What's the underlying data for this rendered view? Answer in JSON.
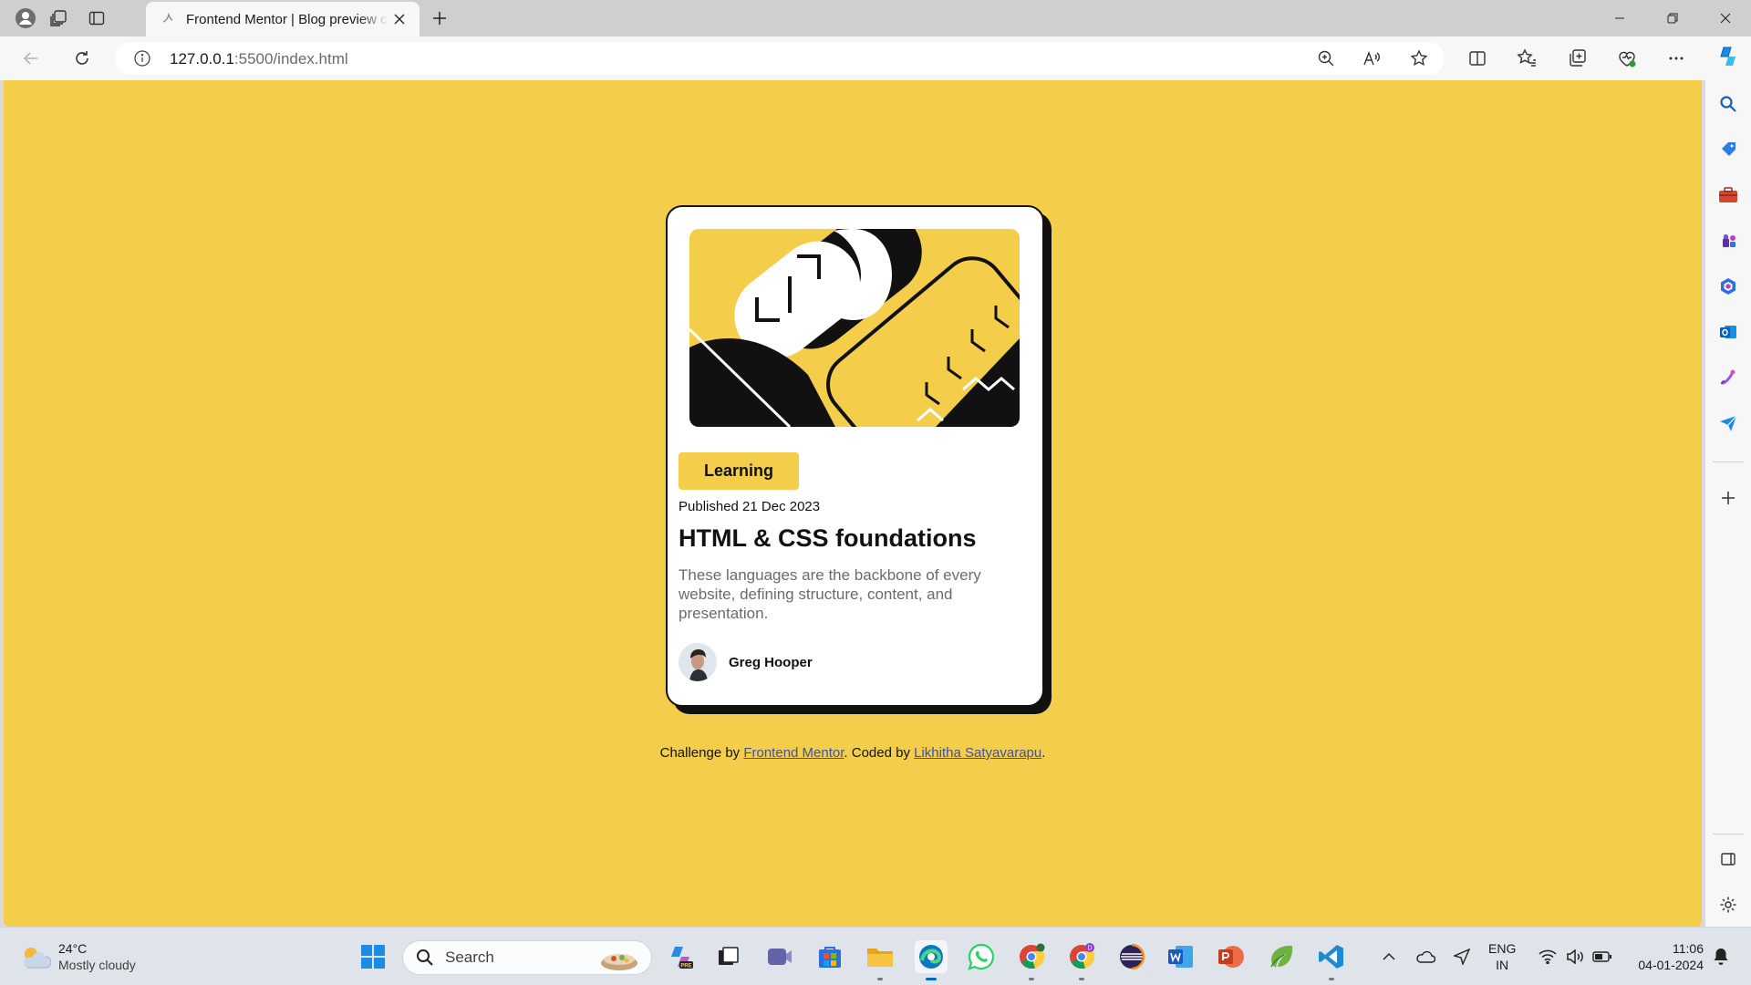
{
  "browser": {
    "tab_title": "Frontend Mentor | Blog preview card",
    "url_host": "127.0.0.1",
    "url_rest": ":5500/index.html"
  },
  "page": {
    "background_color": "#f4ce4b",
    "card": {
      "tag": "Learning",
      "published": "Published 21 Dec 2023",
      "title": "HTML & CSS foundations",
      "description": "These languages are the backbone of every website, defining structure, content, and presentation.",
      "author": "Greg Hooper"
    },
    "attribution": {
      "prefix": "Challenge by ",
      "link1": "Frontend Mentor",
      "middle": ". Coded by ",
      "link2": "Likhitha Satyavarapu",
      "suffix": "."
    }
  },
  "taskbar": {
    "weather_temp": "24°C",
    "weather_condition": "Mostly cloudy",
    "search_label": "Search",
    "lang_line1": "ENG",
    "lang_line2": "IN",
    "time": "11:06",
    "date": "04-01-2024"
  }
}
